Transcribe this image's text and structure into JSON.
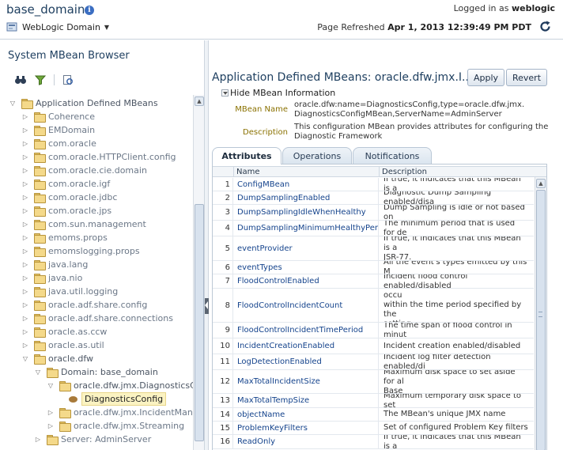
{
  "header": {
    "domain_name": "base_domain",
    "logged_in_label": "Logged in as",
    "user": "weblogic",
    "domain_menu": "WebLogic Domain",
    "page_refreshed_label": "Page Refreshed",
    "page_refreshed_time": "Apr 1, 2013 12:39:49 PM PDT"
  },
  "left": {
    "title": "System MBean Browser",
    "toolbar": [
      "find-icon",
      "filter-icon",
      "refresh-tree-icon"
    ],
    "tree": [
      {
        "label": "Application Defined MBeans",
        "level": 0,
        "expanded": true
      },
      {
        "label": "Coherence",
        "level": 1,
        "expanded": false
      },
      {
        "label": "EMDomain",
        "level": 1,
        "expanded": false
      },
      {
        "label": "com.oracle",
        "level": 1,
        "expanded": false
      },
      {
        "label": "com.oracle.HTTPClient.config",
        "level": 1,
        "expanded": false
      },
      {
        "label": "com.oracle.cie.domain",
        "level": 1,
        "expanded": false
      },
      {
        "label": "com.oracle.igf",
        "level": 1,
        "expanded": false
      },
      {
        "label": "com.oracle.jdbc",
        "level": 1,
        "expanded": false
      },
      {
        "label": "com.oracle.jps",
        "level": 1,
        "expanded": false
      },
      {
        "label": "com.sun.management",
        "level": 1,
        "expanded": false
      },
      {
        "label": "emoms.props",
        "level": 1,
        "expanded": false
      },
      {
        "label": "emomslogging.props",
        "level": 1,
        "expanded": false
      },
      {
        "label": "java.lang",
        "level": 1,
        "expanded": false
      },
      {
        "label": "java.nio",
        "level": 1,
        "expanded": false
      },
      {
        "label": "java.util.logging",
        "level": 1,
        "expanded": false
      },
      {
        "label": "oracle.adf.share.config",
        "level": 1,
        "expanded": false
      },
      {
        "label": "oracle.adf.share.connections",
        "level": 1,
        "expanded": false
      },
      {
        "label": "oracle.as.ccw",
        "level": 1,
        "expanded": false
      },
      {
        "label": "oracle.as.util",
        "level": 1,
        "expanded": false
      },
      {
        "label": "oracle.dfw",
        "level": 1,
        "expanded": true
      },
      {
        "label": "Domain: base_domain",
        "level": 2,
        "expanded": true
      },
      {
        "label": "oracle.dfw.jmx.DiagnosticsConf",
        "level": 3,
        "expanded": true
      },
      {
        "label": "DiagnosticsConfig",
        "level": 4,
        "selected": true
      },
      {
        "label": "oracle.dfw.jmx.IncidentManage",
        "level": 3,
        "expanded": false
      },
      {
        "label": "oracle.dfw.jmx.Streaming",
        "level": 3,
        "expanded": false
      },
      {
        "label": "Server: AdminServer",
        "level": 2,
        "expanded": false
      }
    ]
  },
  "main": {
    "title": "Application Defined MBeans: oracle.dfw.jmx.I...",
    "apply_label": "Apply",
    "revert_label": "Revert",
    "hide_info_label": "Hide MBean Information",
    "mbean_name_label": "MBean Name",
    "mbean_name_value": "oracle.dfw:name=DiagnosticsConfig,type=oracle.dfw.jmx.\nDiagnosticsConfigMBean,ServerName=AdminServer",
    "description_label": "Description",
    "description_value": "This configuration MBean provides attributes for configuring the\nDiagnostic Framework",
    "tabs": [
      "Attributes",
      "Operations",
      "Notifications"
    ],
    "active_tab": "Attributes",
    "columns": [
      "Name",
      "Description"
    ],
    "rows": [
      {
        "num": "1",
        "name": "ConfigMBean",
        "desc": "If true, it indicates that this MBean is a"
      },
      {
        "num": "2",
        "name": "DumpSamplingEnabled",
        "desc": "Diagnostic Dump Sampling enabled/disa"
      },
      {
        "num": "3",
        "name": "DumpSamplingIdleWhenHealthy",
        "desc": "Dump Sampling is idle or not based on"
      },
      {
        "num": "4",
        "name": "DumpSamplingMinimumHealthyPeriod",
        "desc": "The minimum period that is used for de"
      },
      {
        "num": "5",
        "name": "eventProvider",
        "desc": "If true, it indicates that this MBean is a\nJSR-77."
      },
      {
        "num": "6",
        "name": "eventTypes",
        "desc": "All the event's types emitted by this M"
      },
      {
        "num": "7",
        "name": "FloodControlEnabled",
        "desc": "Incident flood control enabled/disabled"
      },
      {
        "num": "8",
        "name": "FloodControlIncidentCount",
        "desc": "The number of incidents that can occu\nwithin the time period specified by the\nsetting"
      },
      {
        "num": "9",
        "name": "FloodControlIncidentTimePeriod",
        "desc": "The time span of flood control in minut"
      },
      {
        "num": "10",
        "name": "IncidentCreationEnabled",
        "desc": "Incident creation enabled/disabled"
      },
      {
        "num": "11",
        "name": "LogDetectionEnabled",
        "desc": "Incident log filter detection enabled/di"
      },
      {
        "num": "12",
        "name": "MaxTotalIncidentSize",
        "desc": "Maximum disk space to set aside for al\nBase"
      },
      {
        "num": "13",
        "name": "MaxTotalTempSize",
        "desc": "Maximum temporary disk space to set"
      },
      {
        "num": "14",
        "name": "objectName",
        "desc": "The MBean's unique JMX name"
      },
      {
        "num": "15",
        "name": "ProblemKeyFilters",
        "desc": "Set of configured Problem Key filters"
      },
      {
        "num": "16",
        "name": "ReadOnly",
        "desc": "If true, it indicates that this MBean is a"
      }
    ]
  }
}
